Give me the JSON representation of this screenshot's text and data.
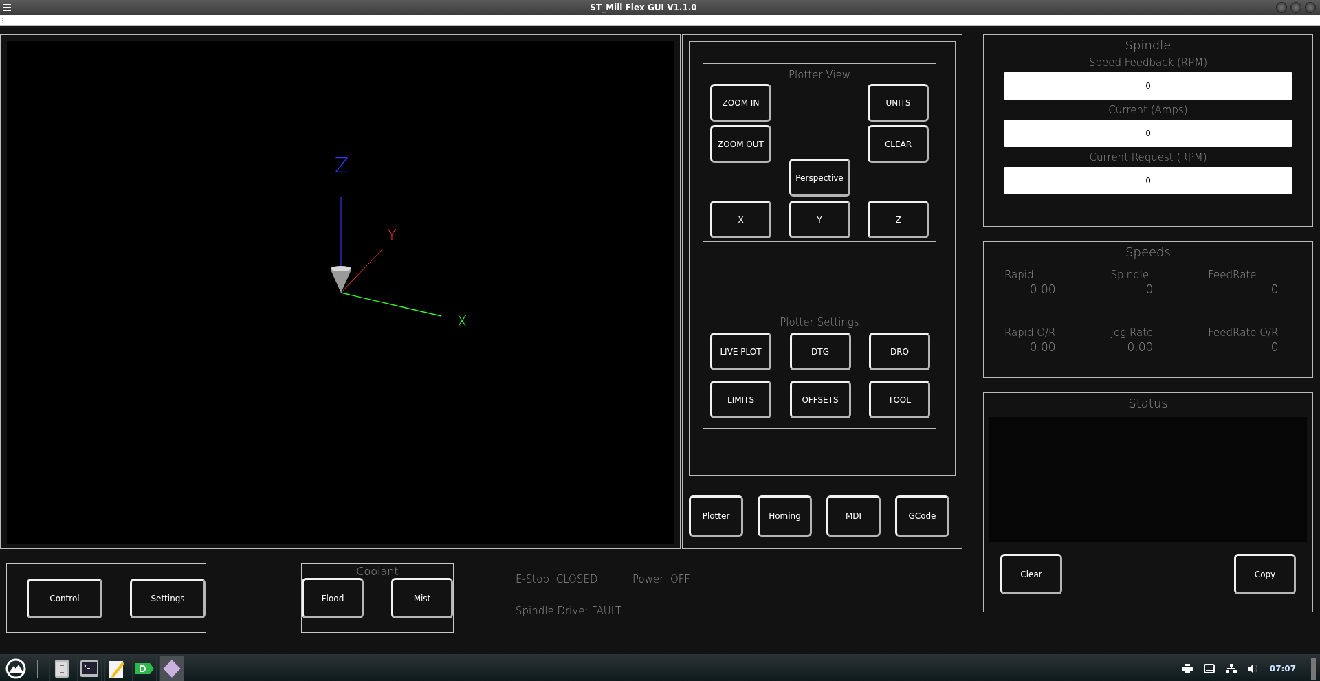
{
  "window": {
    "title": "ST_Mill Flex GUI V1.1.0"
  },
  "plotter": {
    "axis_labels": [
      "Z",
      "Y",
      "X"
    ]
  },
  "plotter_view": {
    "title": "Plotter View",
    "buttons": [
      "ZOOM IN",
      "UNITS",
      "ZOOM OUT",
      "CLEAR",
      "Perspective",
      "X",
      "Y",
      "Z"
    ]
  },
  "plotter_settings": {
    "title": "Plotter Settings",
    "buttons": [
      "LIVE PLOT",
      "DTG",
      "DRO",
      "LIMITS",
      "OFFSETS",
      "TOOL"
    ]
  },
  "page_buttons": [
    "Plotter",
    "Homing",
    "MDI",
    "GCode"
  ],
  "main_buttons": [
    "Control",
    "Settings"
  ],
  "coolant": {
    "title": "Coolant",
    "buttons": [
      "Flood",
      "Mist"
    ]
  },
  "indicators": [
    "E-Stop: CLOSED",
    "Power: OFF",
    "Spindle Drive: FAULT"
  ],
  "spindle": {
    "title": "Spindle",
    "fields": [
      {
        "label": "Speed Feedback (RPM)",
        "value": "0"
      },
      {
        "label": "Current (Amps)",
        "value": "0"
      },
      {
        "label": "Current Request (RPM)",
        "value": "0"
      }
    ]
  },
  "speeds": {
    "title": "Speeds",
    "items": [
      {
        "label": "Rapid",
        "value": "0.00"
      },
      {
        "label": "Spindle",
        "value": "0"
      },
      {
        "label": "FeedRate",
        "value": "0"
      },
      {
        "label": "Rapid O/R",
        "value": "0.00"
      },
      {
        "label": "Jog Rate",
        "value": "0.00"
      },
      {
        "label": "FeedRate O/R",
        "value": "0"
      }
    ]
  },
  "status": {
    "title": "Status",
    "buttons": [
      "Clear",
      "Copy"
    ]
  },
  "taskbar": {
    "clock": "07:07"
  }
}
